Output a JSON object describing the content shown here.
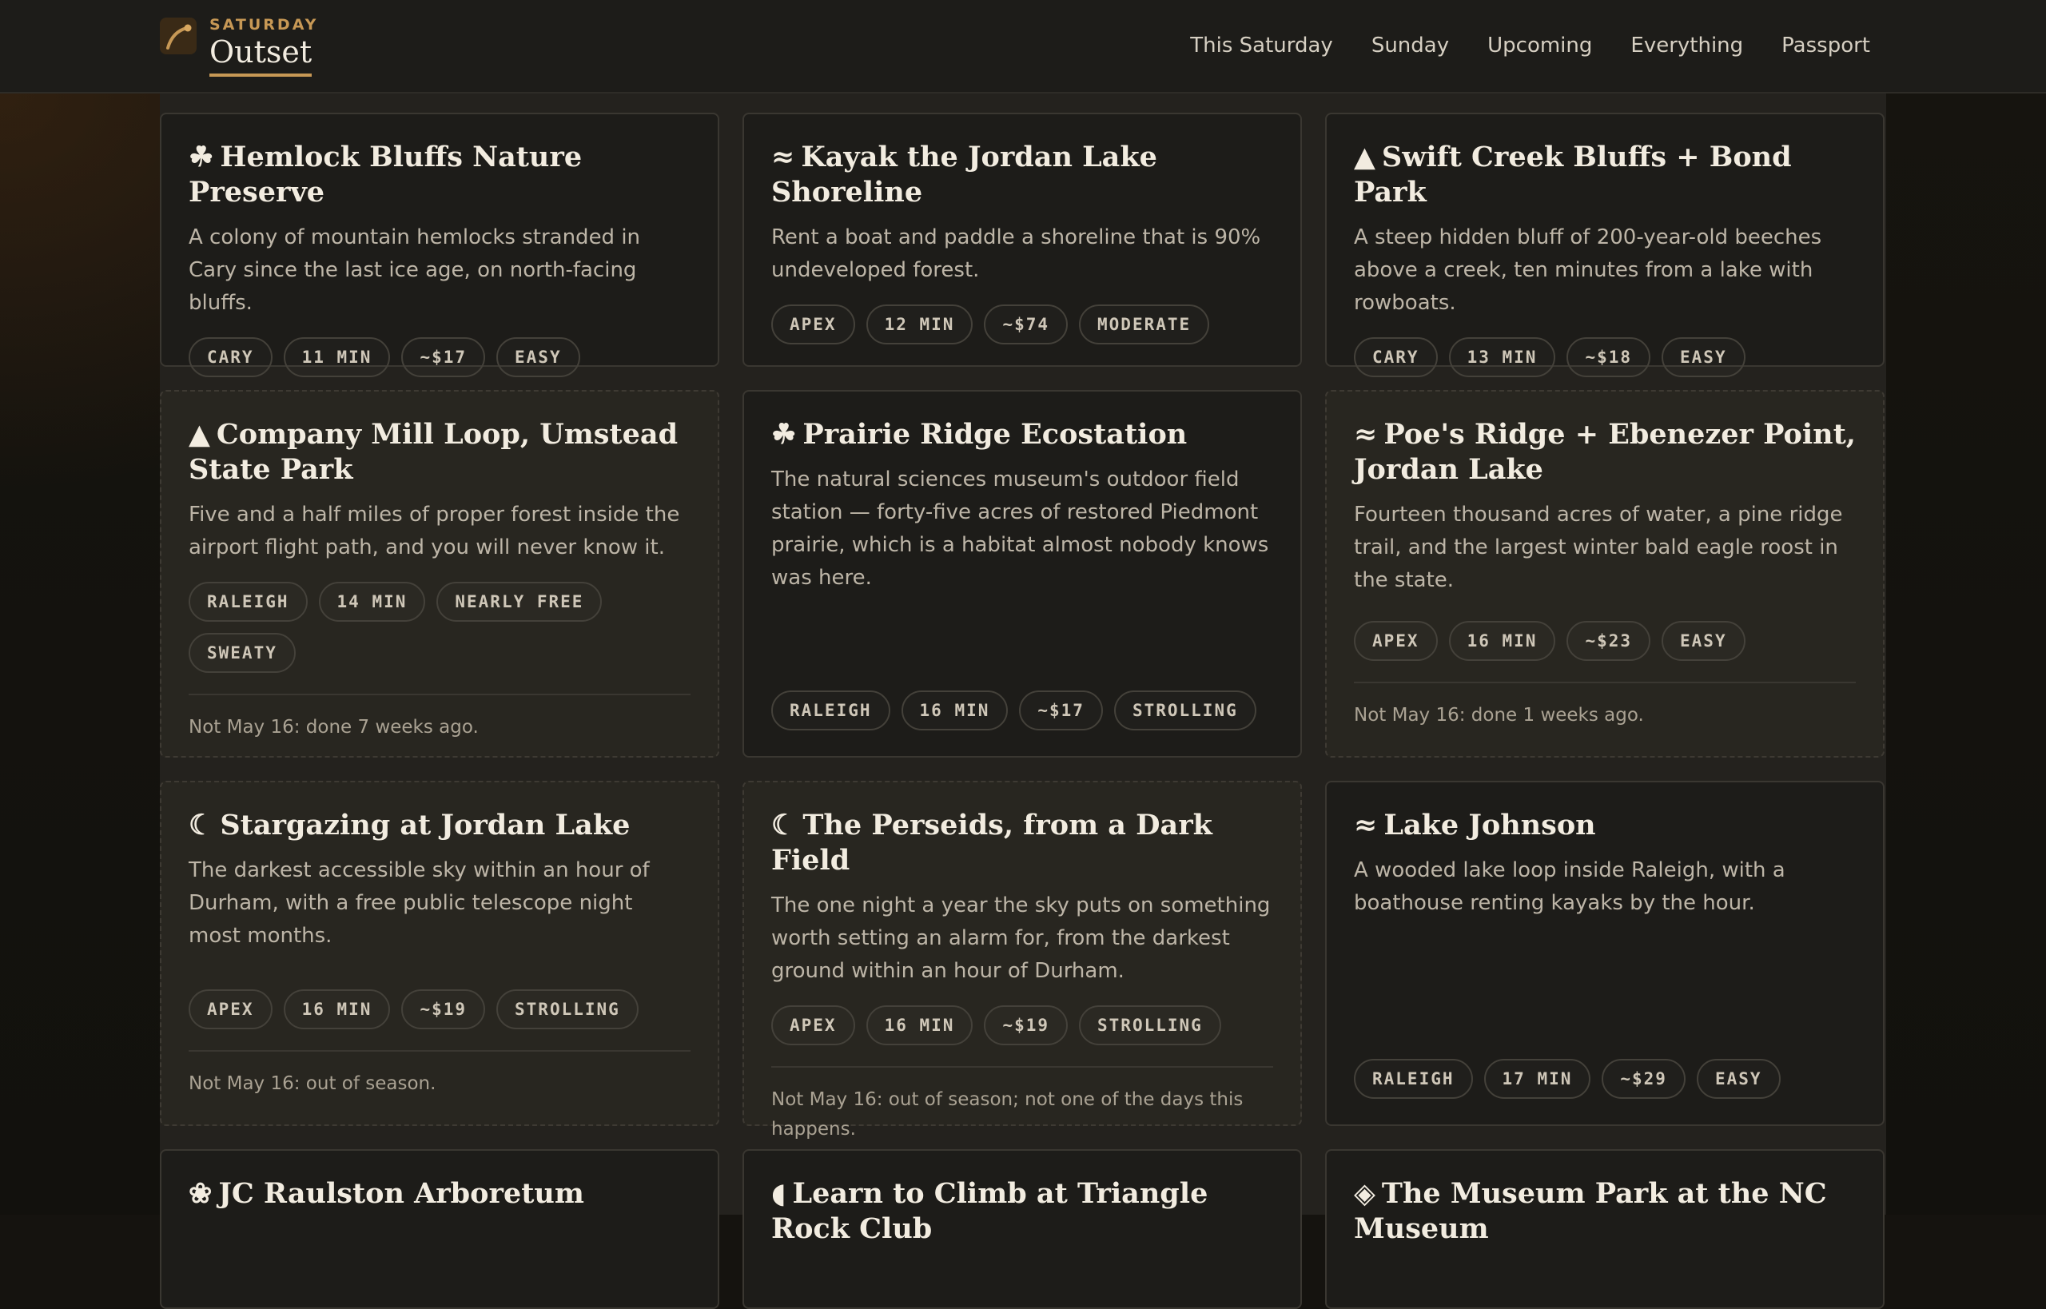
{
  "header": {
    "eyebrow": "SATURDAY",
    "brand": "Outset",
    "nav": [
      "This Saturday",
      "Sunday",
      "Upcoming",
      "Everything",
      "Passport"
    ]
  },
  "cards": [
    {
      "glyph": "☘",
      "icon": "clover-icon",
      "title": "Hemlock Bluffs Nature Preserve",
      "desc": "A colony of mountain hemlocks stranded in Cary since the last ice age, on north-facing bluffs.",
      "tags": [
        "CARY",
        "11 MIN",
        "~$17",
        "EASY"
      ],
      "note": ""
    },
    {
      "glyph": "≈",
      "icon": "water-icon",
      "title": "Kayak the Jordan Lake Shoreline",
      "desc": "Rent a boat and paddle a shoreline that is 90% undeveloped forest.",
      "tags": [
        "APEX",
        "12 MIN",
        "~$74",
        "MODERATE"
      ],
      "note": ""
    },
    {
      "glyph": "▲",
      "icon": "mountain-icon",
      "title": "Swift Creek Bluffs + Bond Park",
      "desc": "A steep hidden bluff of 200-year-old beeches above a creek, ten minutes from a lake with rowboats.",
      "tags": [
        "CARY",
        "13 MIN",
        "~$18",
        "EASY"
      ],
      "note": ""
    },
    {
      "glyph": "▲",
      "icon": "mountain-icon",
      "title": "Company Mill Loop, Umstead State Park",
      "desc": "Five and a half miles of proper forest inside the airport flight path, and you will never know it.",
      "tags": [
        "RALEIGH",
        "14 MIN",
        "NEARLY FREE",
        "SWEATY"
      ],
      "note": "Not May 16: done 7 weeks ago."
    },
    {
      "glyph": "☘",
      "icon": "clover-icon",
      "title": "Prairie Ridge Ecostation",
      "desc": "The natural sciences museum's outdoor field station — forty-five acres of restored Piedmont prairie, which is a habitat almost nobody knows was here.",
      "tags": [
        "RALEIGH",
        "16 MIN",
        "~$17",
        "STROLLING"
      ],
      "note": ""
    },
    {
      "glyph": "≈",
      "icon": "water-icon",
      "title": "Poe's Ridge + Ebenezer Point, Jordan Lake",
      "desc": "Fourteen thousand acres of water, a pine ridge trail, and the largest winter bald eagle roost in the state.",
      "tags": [
        "APEX",
        "16 MIN",
        "~$23",
        "EASY"
      ],
      "note": "Not May 16: done 1 weeks ago."
    },
    {
      "glyph": "☾",
      "icon": "moon-icon",
      "title": "Stargazing at Jordan Lake",
      "desc": "The darkest accessible sky within an hour of Durham, with a free public telescope night most months.",
      "tags": [
        "APEX",
        "16 MIN",
        "~$19",
        "STROLLING"
      ],
      "note": "Not May 16: out of season."
    },
    {
      "glyph": "☾",
      "icon": "moon-icon",
      "title": "The Perseids, from a Dark Field",
      "desc": "The one night a year the sky puts on something worth setting an alarm for, from the darkest ground within an hour of Durham.",
      "tags": [
        "APEX",
        "16 MIN",
        "~$19",
        "STROLLING"
      ],
      "note": "Not May 16: out of season; not one of the days this happens."
    },
    {
      "glyph": "≈",
      "icon": "water-icon",
      "title": "Lake Johnson",
      "desc": "A wooded lake loop inside Raleigh, with a boathouse renting kayaks by the hour.",
      "tags": [
        "RALEIGH",
        "17 MIN",
        "~$29",
        "EASY"
      ],
      "note": ""
    },
    {
      "glyph": "❀",
      "icon": "flower-icon",
      "title": "JC Raulston Arboretum",
      "desc": "",
      "tags": [],
      "note": ""
    },
    {
      "glyph": "◖",
      "icon": "climbing-hold-icon",
      "title": "Learn to Climb at Triangle Rock Club",
      "desc": "",
      "tags": [],
      "note": ""
    },
    {
      "glyph": "◈",
      "icon": "diamond-icon",
      "title": "The Museum Park at the NC Museum",
      "desc": "",
      "tags": [],
      "note": ""
    }
  ],
  "colors": {
    "accent": "#c79855",
    "background": "#15130f",
    "card": "#1d1c19"
  }
}
